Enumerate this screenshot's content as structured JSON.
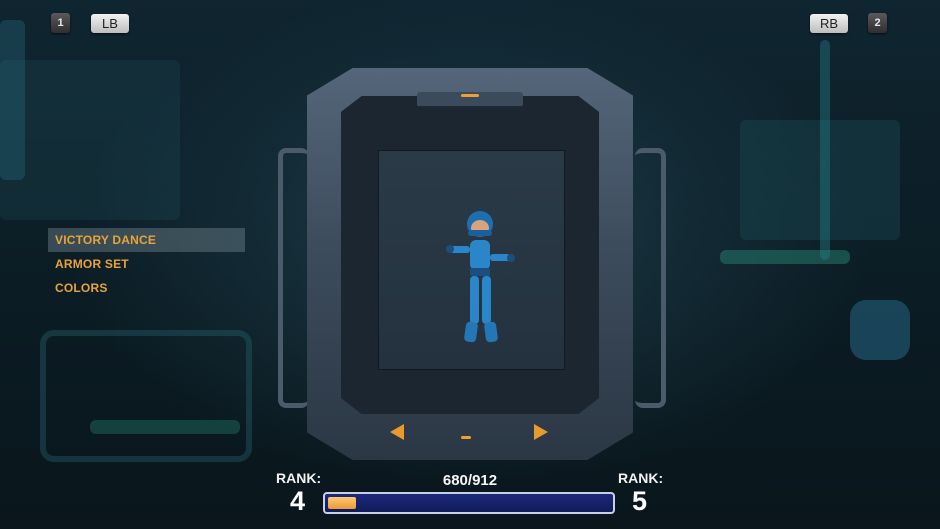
{
  "top_left": {
    "badge": "1",
    "button": "LB"
  },
  "top_right": {
    "badge": "2",
    "button": "RB"
  },
  "menu": {
    "items": [
      {
        "label": "VICTORY DANCE",
        "selected": true
      },
      {
        "label": "ARMOR SET",
        "selected": false
      },
      {
        "label": "COLORS",
        "selected": false
      }
    ]
  },
  "rank": {
    "current_label": "RANK:",
    "current_value": "4",
    "next_label": "RANK:",
    "next_value": "5",
    "progress_text": "680/912",
    "progress_fraction": 0.1
  },
  "colors": {
    "menu_text": "#e8a33a",
    "bar_fill": "#e99b38",
    "bar_bg": "#1a2a7a"
  },
  "icons": {
    "left_arrow": "left-arrow-icon",
    "right_arrow": "right-arrow-icon"
  }
}
